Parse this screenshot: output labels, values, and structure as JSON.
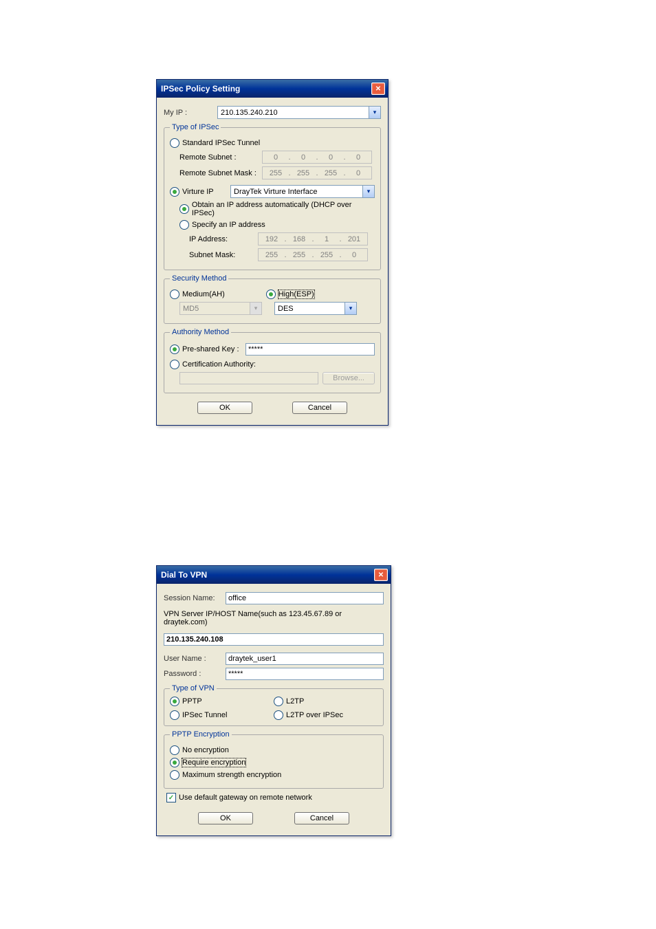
{
  "dlg1": {
    "title": "IPSec Policy Setting",
    "myip_label": "My IP :",
    "myip_value": "210.135.240.210",
    "fieldset_ipsec_type": "Type of IPSec",
    "standard_tunnel_label": "Standard IPSec Tunnel",
    "remote_subnet_label": "Remote Subnet :",
    "remote_subnet_value": [
      "0",
      "0",
      "0",
      "0"
    ],
    "remote_mask_label": "Remote Subnet Mask :",
    "remote_mask_value": [
      "255",
      "255",
      "255",
      "0"
    ],
    "virtual_ip_label": "Virture IP",
    "virtual_iface_value": "DrayTek Virture Interface",
    "obtain_dhcp_label": "Obtain an IP address automatically (DHCP over IPSec)",
    "specify_ip_label": "Specify an IP address",
    "ip_address_label": "IP Address:",
    "ip_address_value": [
      "192",
      "168",
      "1",
      "201"
    ],
    "subnet_mask_label": "Subnet Mask:",
    "subnet_mask_value": [
      "255",
      "255",
      "255",
      "0"
    ],
    "fieldset_security": "Security Method",
    "medium_label": "Medium(AH)",
    "high_label": "High(ESP)",
    "ah_algo": "MD5",
    "esp_algo": "DES",
    "fieldset_authority": "Authority Method",
    "psk_label": "Pre-shared Key :",
    "psk_value": "*****",
    "ca_label": "Certification Authority:",
    "browse_label": "Browse...",
    "ok_label": "OK",
    "cancel_label": "Cancel"
  },
  "dlg2": {
    "title": "Dial To VPN",
    "session_name_label": "Session Name:",
    "session_name_value": "office",
    "server_hint": "VPN Server IP/HOST Name(such as 123.45.67.89 or draytek.com)",
    "server_value": "210.135.240.108",
    "username_label": "User Name :",
    "username_value": "draytek_user1",
    "password_label": "Password :",
    "password_value": "*****",
    "fieldset_vpn_type": "Type of VPN",
    "pptp_label": "PPTP",
    "l2tp_label": "L2TP",
    "ipsec_tunnel_label": "IPSec Tunnel",
    "l2tp_ipsec_label": "L2TP over IPSec",
    "fieldset_pptp_enc": "PPTP Encryption",
    "no_enc_label": "No encryption",
    "req_enc_label": "Require encryption",
    "max_enc_label": "Maximum strength encryption",
    "default_gw_label": "Use default gateway on remote network",
    "ok_label": "OK",
    "cancel_label": "Cancel"
  }
}
